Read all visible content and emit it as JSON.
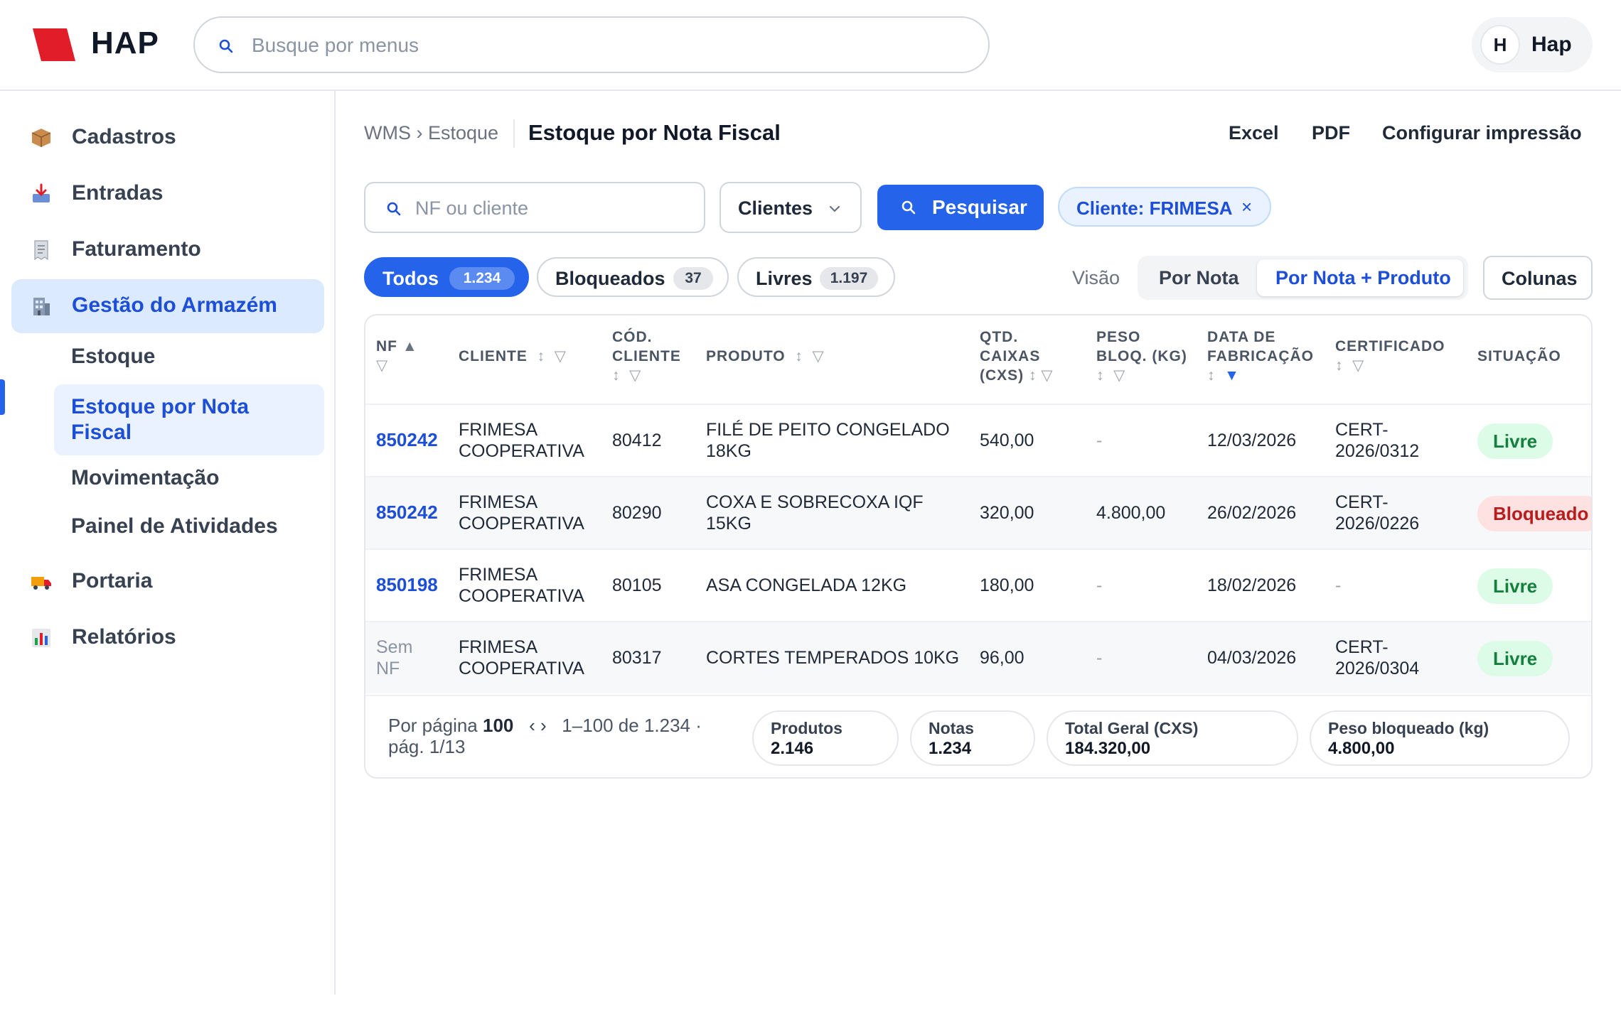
{
  "brand": {
    "name": "HAP",
    "accent": "#e11d2a"
  },
  "search": {
    "placeholder": "Busque por menus",
    "icon": "search-icon"
  },
  "user": {
    "initial": "H",
    "name": "Hap"
  },
  "sidebar": {
    "items": [
      {
        "label": "Cadastros",
        "icon": "package-icon"
      },
      {
        "label": "Entradas",
        "icon": "inbox-tray-icon"
      },
      {
        "label": "Faturamento",
        "icon": "receipt-icon"
      },
      {
        "label": "Gestão do Armazém",
        "icon": "building-icon",
        "active": true
      },
      {
        "label": "Portaria",
        "icon": "truck-icon"
      },
      {
        "label": "Relatórios",
        "icon": "bar-chart-icon"
      }
    ],
    "subitems": [
      {
        "label": "Estoque"
      },
      {
        "label": "Estoque por Nota Fiscal",
        "active": true
      },
      {
        "label": "Movimentação"
      },
      {
        "label": "Painel de Atividades"
      }
    ]
  },
  "header": {
    "breadcrumb": "WMS › Estoque",
    "title": "Estoque por Nota Fiscal",
    "actions": [
      "Excel",
      "PDF",
      "Configurar impressão"
    ]
  },
  "filters": {
    "nf_placeholder": "NF ou cliente",
    "select_value": "Clientes",
    "search_button": "Pesquisar",
    "active_chip": "Cliente: FRIMESA",
    "chip_close": "×"
  },
  "tabs": [
    {
      "label": "Todos",
      "count": "1.234",
      "active": true
    },
    {
      "label": "Bloqueados",
      "count": "37"
    },
    {
      "label": "Livres",
      "count": "1.197"
    }
  ],
  "view": {
    "label": "Visão",
    "options": [
      "Por Nota",
      "Por Nota + Produto"
    ],
    "selected": "Por Nota + Produto",
    "columns_button": "Colunas"
  },
  "table": {
    "headers": {
      "nf": "NF",
      "cliente": "CLIENTE",
      "cod_cliente": "CÓD. CLIENTE",
      "produto": "PRODUTO",
      "qtd_caixas": "QTD. CAIXAS (CXS)",
      "peso_bloq": "PESO BLOQ. (KG)",
      "data_fab": "DATA DE FABRICAÇÃO",
      "certificado": "CERTIFICADO",
      "situacao": "SITUAÇÃO"
    },
    "rows": [
      {
        "nf": "850242",
        "cliente": "FRIMESA COOPERATIVA",
        "cod": "80412",
        "produto": "FILÉ DE PEITO CONGELADO 18KG",
        "qtd": "540,00",
        "peso": "-",
        "data": "12/03/2026",
        "cert": "CERT-2026/0312",
        "situacao": "Livre"
      },
      {
        "nf": "850242",
        "cliente": "FRIMESA COOPERATIVA",
        "cod": "80290",
        "produto": "COXA E SOBRECOXA IQF 15KG",
        "qtd": "320,00",
        "peso": "4.800,00",
        "data": "26/02/2026",
        "cert": "CERT-2026/0226",
        "situacao": "Bloqueado"
      },
      {
        "nf": "850198",
        "cliente": "FRIMESA COOPERATIVA",
        "cod": "80105",
        "produto": "ASA CONGELADA 12KG",
        "qtd": "180,00",
        "peso": "-",
        "data": "18/02/2026",
        "cert": "-",
        "situacao": "Livre"
      },
      {
        "nf": "Sem NF",
        "cliente": "FRIMESA COOPERATIVA",
        "cod": "80317",
        "produto": "CORTES TEMPERADOS 10KG",
        "qtd": "96,00",
        "peso": "-",
        "data": "04/03/2026",
        "cert": "CERT-2026/0304",
        "situacao": "Livre"
      }
    ]
  },
  "footer": {
    "per_page_label": "Por página",
    "per_page": "100",
    "nav": "‹ ›",
    "range": "1–100 de 1.234 ·",
    "page": "pág. 1/13",
    "stats": [
      {
        "label": "Produtos",
        "value": "2.146"
      },
      {
        "label": "Notas",
        "value": "1.234"
      },
      {
        "label": "Total Geral (CXS)",
        "value": "184.320,00"
      },
      {
        "label": "Peso bloqueado (kg)",
        "value": "4.800,00"
      }
    ]
  }
}
